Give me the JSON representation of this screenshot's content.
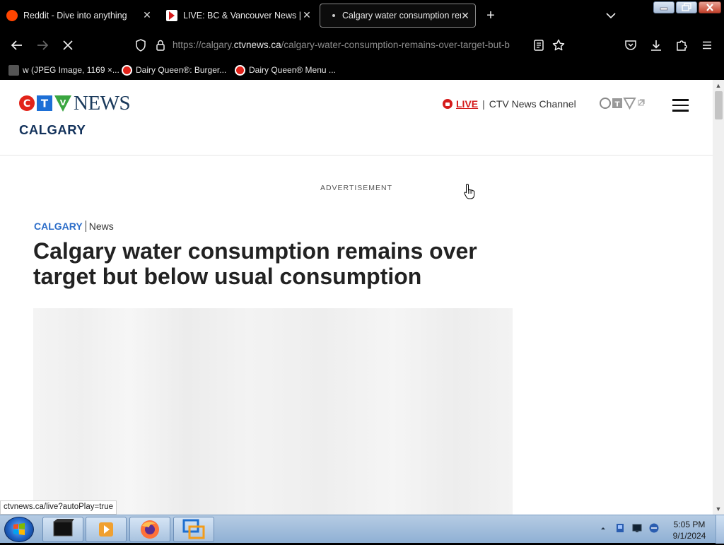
{
  "browser": {
    "tabs": [
      {
        "title": "Reddit - Dive into anything",
        "favicon": "reddit-icon",
        "active": false
      },
      {
        "title": "LIVE: BC & Vancouver News | W",
        "favicon": "ctv-play-icon",
        "active": false
      },
      {
        "title": "Calgary water consumption rem",
        "favicon": "loading-dot-icon",
        "active": true
      }
    ],
    "url_prefix": "https://calgary.",
    "url_host": "ctvnews.ca",
    "url_path": "/calgary-water-consumption-remains-over-target-but-b",
    "bookmarks": [
      {
        "label": "w (JPEG Image, 1169 ×...",
        "icon": "image-icon"
      },
      {
        "label": "Dairy Queen®: Burger...",
        "icon": "dq-icon"
      },
      {
        "label": "Dairy Queen® Menu ...",
        "icon": "dq-icon"
      }
    ]
  },
  "site": {
    "logo_news": "NEWS",
    "city": "CALGARY",
    "live_label": "LIVE",
    "separator": "|",
    "channel_label": "CTV News Channel"
  },
  "page": {
    "ad_label": "ADVERTISEMENT",
    "breadcrumb_city": "CALGARY",
    "breadcrumb_section": "News",
    "headline": "Calgary water consumption remains over target but below usual consumption"
  },
  "status_bar": {
    "link": "ctvnews.ca/live?autoPlay=true"
  },
  "taskbar": {
    "time": "5:05 PM",
    "date": "9/1/2024"
  },
  "colors": {
    "brand_navy": "#13325b",
    "live_red": "#d51b1b",
    "crumb_blue": "#2d6ec9"
  }
}
